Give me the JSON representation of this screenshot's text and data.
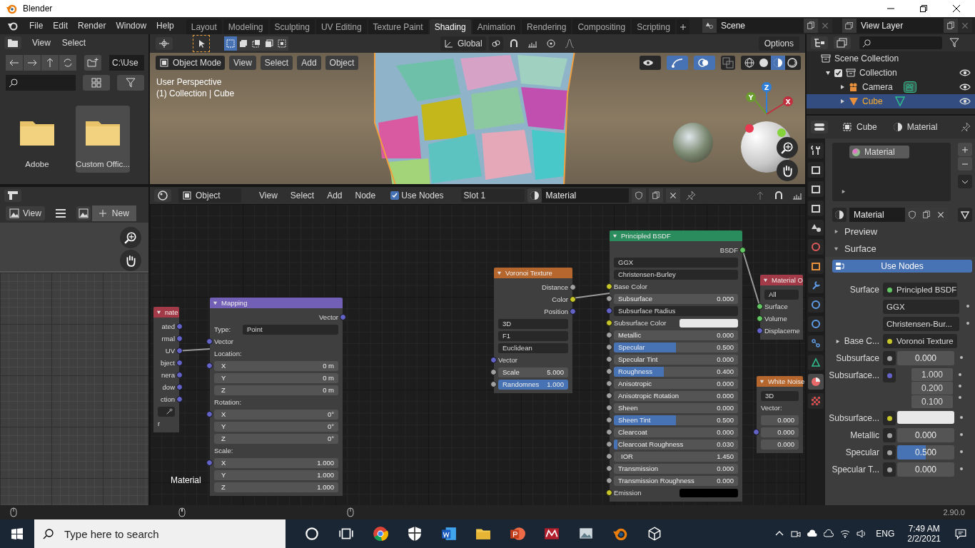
{
  "window": {
    "title": "Blender"
  },
  "menu": [
    "File",
    "Edit",
    "Render",
    "Window",
    "Help"
  ],
  "workspace_tabs": [
    {
      "label": "Layout",
      "selected": false
    },
    {
      "label": "Modeling",
      "selected": false
    },
    {
      "label": "Sculpting",
      "selected": false
    },
    {
      "label": "UV Editing",
      "selected": false
    },
    {
      "label": "Texture Paint",
      "selected": false
    },
    {
      "label": "Shading",
      "selected": true
    },
    {
      "label": "Animation",
      "selected": false
    },
    {
      "label": "Rendering",
      "selected": false
    },
    {
      "label": "Compositing",
      "selected": false
    },
    {
      "label": "Scripting",
      "selected": false
    }
  ],
  "scene": "Scene",
  "view_layer": "View Layer",
  "file_browser": {
    "menu": [
      "View",
      "Select"
    ],
    "path": "C:\\Use",
    "folders": [
      {
        "name": "Adobe",
        "selected": false
      },
      {
        "name": "Custom Offic...",
        "selected": true
      }
    ]
  },
  "viewport": {
    "orientation": "Global",
    "options": "Options",
    "mode": "Object Mode",
    "menu": [
      "View",
      "Select",
      "Add",
      "Object"
    ],
    "overlay_text": [
      "User Perspective",
      "(1) Collection | Cube"
    ],
    "gizmo_axes": [
      "Z",
      "Y",
      "X"
    ]
  },
  "outliner": {
    "root": "Scene Collection",
    "items": [
      {
        "name": "Collection",
        "checked": true,
        "expanded": true,
        "children": [
          {
            "name": "Camera",
            "selected": false
          },
          {
            "name": "Cube",
            "selected": true
          }
        ]
      }
    ]
  },
  "image_editor": {
    "view": "View",
    "new": "New"
  },
  "node_editor": {
    "type": "Object",
    "menu": [
      "View",
      "Select",
      "Add",
      "Node"
    ],
    "use_nodes": {
      "label": "Use Nodes",
      "checked": true
    },
    "slot": "Slot 1",
    "material": "Material",
    "frame_label": "Material",
    "nodes": [
      {
        "title": "nate",
        "color": "#a33a47",
        "rows": [
          {
            "kind": "output",
            "label": "ated",
            "color": "#6363c7"
          },
          {
            "kind": "output",
            "label": "rmal",
            "color": "#6363c7"
          },
          {
            "kind": "output",
            "label": "UV",
            "color": "#6363c7"
          },
          {
            "kind": "output",
            "label": "bject",
            "color": "#6363c7"
          },
          {
            "kind": "output",
            "label": "nera",
            "color": "#6363c7"
          },
          {
            "kind": "output",
            "label": "dow",
            "color": "#6363c7"
          },
          {
            "kind": "output",
            "label": "ction",
            "color": "#6363c7"
          },
          {
            "kind": "picker"
          },
          {
            "kind": "heading",
            "label": "r"
          }
        ]
      },
      {
        "title": "Mapping",
        "color": "#7160b5",
        "rows": [
          {
            "kind": "output",
            "label": "Vector",
            "color": "#6363c7"
          },
          {
            "kind": "select",
            "label": "Type:",
            "value": "Point"
          },
          {
            "kind": "input",
            "label": "Vector",
            "color": "#6363c7"
          },
          {
            "kind": "heading",
            "label": "Location:"
          },
          {
            "kind": "number",
            "label": "X",
            "value": "0 m",
            "color": "#6363c7"
          },
          {
            "kind": "number",
            "label": "Y",
            "value": "0 m"
          },
          {
            "kind": "number",
            "label": "Z",
            "value": "0 m"
          },
          {
            "kind": "heading",
            "label": "Rotation:"
          },
          {
            "kind": "number",
            "label": "X",
            "value": "0°",
            "color": "#6363c7"
          },
          {
            "kind": "number",
            "label": "Y",
            "value": "0°"
          },
          {
            "kind": "number",
            "label": "Z",
            "value": "0°"
          },
          {
            "kind": "heading",
            "label": "Scale:"
          },
          {
            "kind": "number",
            "label": "X",
            "value": "1.000",
            "color": "#6363c7"
          },
          {
            "kind": "number",
            "label": "Y",
            "value": "1.000"
          },
          {
            "kind": "number",
            "label": "Z",
            "value": "1.000"
          }
        ]
      },
      {
        "title": "Voronoi Texture",
        "color": "#b5672e",
        "rows": [
          {
            "kind": "output",
            "label": "Distance",
            "color": "#a1a1a1"
          },
          {
            "kind": "output",
            "label": "Color",
            "color": "#c7c729"
          },
          {
            "kind": "output",
            "label": "Position",
            "color": "#6363c7"
          },
          {
            "kind": "select",
            "value": "3D"
          },
          {
            "kind": "select",
            "value": "F1"
          },
          {
            "kind": "select",
            "value": "Euclidean"
          },
          {
            "kind": "input",
            "label": "Vector",
            "color": "#6363c7"
          },
          {
            "kind": "field",
            "label": "Scale",
            "value": "5.000",
            "level": 0,
            "color": "#a1a1a1"
          },
          {
            "kind": "field",
            "label": "Randomnes",
            "value": "1.000",
            "level": 1,
            "color": "#a1a1a1"
          }
        ]
      },
      {
        "title": "Principled BSDF",
        "color": "#2a8b5c",
        "rows": [
          {
            "kind": "output",
            "label": "BSDF",
            "color": "#63c763"
          },
          {
            "kind": "select",
            "value": "GGX"
          },
          {
            "kind": "select",
            "value": "Christensen-Burley"
          },
          {
            "kind": "input",
            "label": "Base Color",
            "color": "#c7c729"
          },
          {
            "kind": "field",
            "label": "Subsurface",
            "value": "0.000",
            "level": 0,
            "color": "#a1a1a1"
          },
          {
            "kind": "select",
            "value": "Subsurface Radius",
            "color": "#6363c7"
          },
          {
            "kind": "color",
            "label": "Subsurface Color",
            "color": "#e8e8e8",
            "socket": {
              "color": "#c7c729"
            }
          },
          {
            "kind": "field",
            "label": "Metallic",
            "value": "0.000",
            "level": 0,
            "color": "#a1a1a1"
          },
          {
            "kind": "field",
            "label": "Specular",
            "value": "0.500",
            "level": 0.5,
            "color": "#a1a1a1"
          },
          {
            "kind": "field",
            "label": "Specular Tint",
            "value": "0.000",
            "level": 0,
            "color": "#a1a1a1"
          },
          {
            "kind": "field",
            "label": "Roughness",
            "value": "0.400",
            "level": 0.4,
            "color": "#a1a1a1"
          },
          {
            "kind": "field",
            "label": "Anisotropic",
            "value": "0.000",
            "level": 0,
            "color": "#a1a1a1"
          },
          {
            "kind": "field",
            "label": "Anisotropic Rotation",
            "value": "0.000",
            "level": 0,
            "color": "#a1a1a1"
          },
          {
            "kind": "field",
            "label": "Sheen",
            "value": "0.000",
            "level": 0,
            "color": "#a1a1a1"
          },
          {
            "kind": "field",
            "label": "Sheen Tint",
            "value": "0.500",
            "level": 0.5,
            "color": "#a1a1a1"
          },
          {
            "kind": "field",
            "label": "Clearcoat",
            "value": "0.000",
            "level": 0,
            "color": "#a1a1a1"
          },
          {
            "kind": "field",
            "label": "Clearcoat Roughness",
            "value": "0.030",
            "level": 0.03,
            "color": "#a1a1a1"
          },
          {
            "kind": "number",
            "label": "IOR",
            "value": "1.450",
            "color": "#a1a1a1"
          },
          {
            "kind": "field",
            "label": "Transmission",
            "value": "0.000",
            "level": 0,
            "color": "#a1a1a1"
          },
          {
            "kind": "field",
            "label": "Transmission Roughness",
            "value": "0.000",
            "level": 0,
            "color": "#a1a1a1"
          },
          {
            "kind": "color",
            "label": "Emission",
            "color": "#000000",
            "socket": {
              "color": "#c7c729"
            }
          }
        ]
      },
      {
        "title": "Material O",
        "color": "#a33a47",
        "rows": [
          {
            "kind": "select",
            "value": "All"
          },
          {
            "kind": "input",
            "label": "Surface",
            "color": "#63c763"
          },
          {
            "kind": "input",
            "label": "Volume",
            "color": "#63c763"
          },
          {
            "kind": "input",
            "label": "Displaceme",
            "color": "#6363c7"
          }
        ]
      },
      {
        "title": "White Noise",
        "color": "#b5672e",
        "rows": [
          {
            "kind": "select",
            "value": "3D"
          },
          {
            "kind": "heading",
            "label": "Vector:"
          },
          {
            "kind": "number",
            "value": "0.000"
          },
          {
            "kind": "number",
            "value": "0.000",
            "color": "#6363c7"
          },
          {
            "kind": "number",
            "value": "0.000"
          }
        ]
      }
    ]
  },
  "properties": {
    "context": [
      "Cube",
      "Material"
    ],
    "tabs": [
      {
        "kind": "tool",
        "selected": false
      },
      {
        "kind": "render",
        "selected": false
      },
      {
        "kind": "output",
        "selected": false
      },
      {
        "kind": "view-layer",
        "selected": false
      },
      {
        "kind": "scene",
        "selected": false
      },
      {
        "kind": "world",
        "selected": false
      },
      {
        "kind": "object",
        "selected": false
      },
      {
        "kind": "modifier",
        "selected": false
      },
      {
        "kind": "particles",
        "selected": false
      },
      {
        "kind": "physics",
        "selected": false
      },
      {
        "kind": "constraints",
        "selected": false
      },
      {
        "kind": "data",
        "selected": false
      },
      {
        "kind": "material",
        "selected": true
      },
      {
        "kind": "texture",
        "selected": false
      }
    ],
    "slots": [
      {
        "name": "Material",
        "selected": true
      }
    ],
    "material": "Material",
    "panels": [
      {
        "title": "Preview",
        "expanded": false
      },
      {
        "title": "Surface",
        "expanded": true
      }
    ],
    "use_nodes": "Use Nodes",
    "rows": [
      {
        "kind": "link",
        "label": "Surface",
        "value": "Principled BSDF",
        "color": "#63c763"
      },
      {
        "kind": "select",
        "value": "GGX"
      },
      {
        "kind": "select",
        "value": "Christensen-Bur..."
      },
      {
        "kind": "link",
        "label": "Base C...",
        "value": "Voronoi Texture",
        "color": "#c7c729",
        "expanded": false
      },
      {
        "kind": "field",
        "label": "Subsurface",
        "value": "0.000",
        "level": 0,
        "color": "#a1a1a1"
      },
      {
        "kind": "vector",
        "label": "Subsurface...",
        "values": [
          "1.000",
          "0.200",
          "0.100"
        ],
        "color": "#6363c7"
      },
      {
        "kind": "color",
        "label": "Subsurface...",
        "color": "#e8e8e8",
        "socket": {
          "color": "#c7c729"
        }
      },
      {
        "kind": "field",
        "label": "Metallic",
        "value": "0.000",
        "level": 0,
        "color": "#a1a1a1"
      },
      {
        "kind": "field",
        "label": "Specular",
        "value": "0.500",
        "level": 0.5,
        "color": "#a1a1a1"
      },
      {
        "kind": "field",
        "label": "Specular T...",
        "value": "0.000",
        "level": 0,
        "color": "#a1a1a1"
      }
    ]
  },
  "status_bar": {
    "version": "2.90.0"
  },
  "taskbar": {
    "search_placeholder": "Type here to search",
    "language": "ENG",
    "time": "7:49 AM",
    "date": "2/2/2021"
  }
}
